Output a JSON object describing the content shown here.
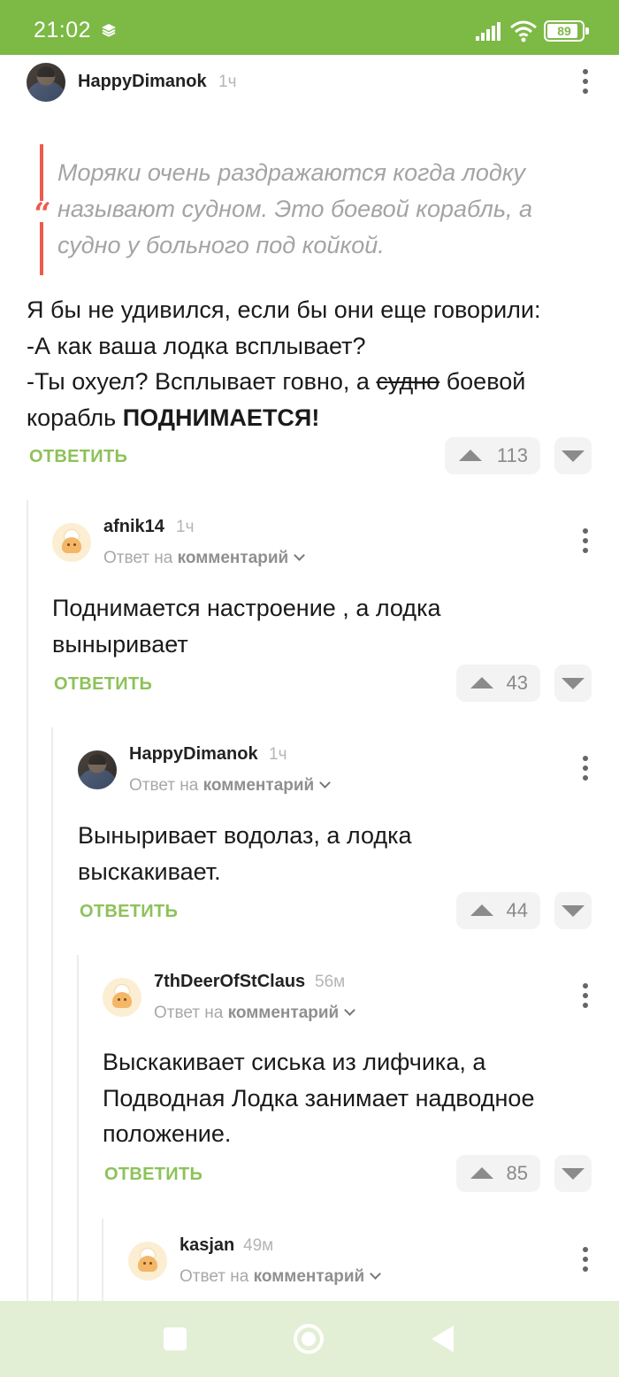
{
  "status_bar": {
    "time": "21:02",
    "battery": "89",
    "battery_level": 0.89,
    "accent_color": "#7db945"
  },
  "comments": [
    {
      "username": "HappyDimanok",
      "time": "1ч",
      "avatar": "photo",
      "quote": "Моряки очень раздражаются когда лодку называют судном. Это боевой корабль, а судно у больного под койкой.",
      "text_line1": "Я бы не удивился, если бы они еще говорили:",
      "text_line2": "-А как ваша лодка всплывает?",
      "text_line3_a": "-Ты охуел? Всплывает говно, а ",
      "text_line3_strike": "судно",
      "text_line3_b": " боевой",
      "text_line4_a": "корабль ",
      "text_line4_bold": "ПОДНИМАЕТСЯ!",
      "reply_label": "ОТВЕТИТЬ",
      "votes": "113"
    },
    {
      "username": "afnik14",
      "time": "1ч",
      "avatar": "default",
      "reply_to_prefix": "Ответ на",
      "reply_to_target": "комментарий",
      "text": "Поднимается настроение , а лодка выныривает",
      "reply_label": "ОТВЕТИТЬ",
      "votes": "43"
    },
    {
      "username": "HappyDimanok",
      "time": "1ч",
      "avatar": "photo",
      "reply_to_prefix": "Ответ на",
      "reply_to_target": "комментарий",
      "text": "Выныривает водолаз, а лодка выскакивает.",
      "reply_label": "ОТВЕТИТЬ",
      "votes": "44"
    },
    {
      "username": "7thDeerOfStClaus",
      "time": "56м",
      "avatar": "default",
      "reply_to_prefix": "Ответ на",
      "reply_to_target": "комментарий",
      "text": "Выскакивает сиська из лифчика, а Подводная Лодка занимает надводное положение.",
      "reply_label": "ОТВЕТИТЬ",
      "votes": "85"
    },
    {
      "username": "kasjan",
      "time": "49м",
      "avatar": "default",
      "reply_to_prefix": "Ответ на",
      "reply_to_target": "комментарий"
    }
  ],
  "icons": {
    "quote": "quote-icon",
    "more": "more-vertical-icon",
    "upvote": "arrow-up-icon",
    "downvote": "arrow-down-icon"
  },
  "colors": {
    "reply_link": "#8dc259",
    "quote_bar": "#ef5a4b",
    "navbar_bg": "#e2efd5"
  }
}
